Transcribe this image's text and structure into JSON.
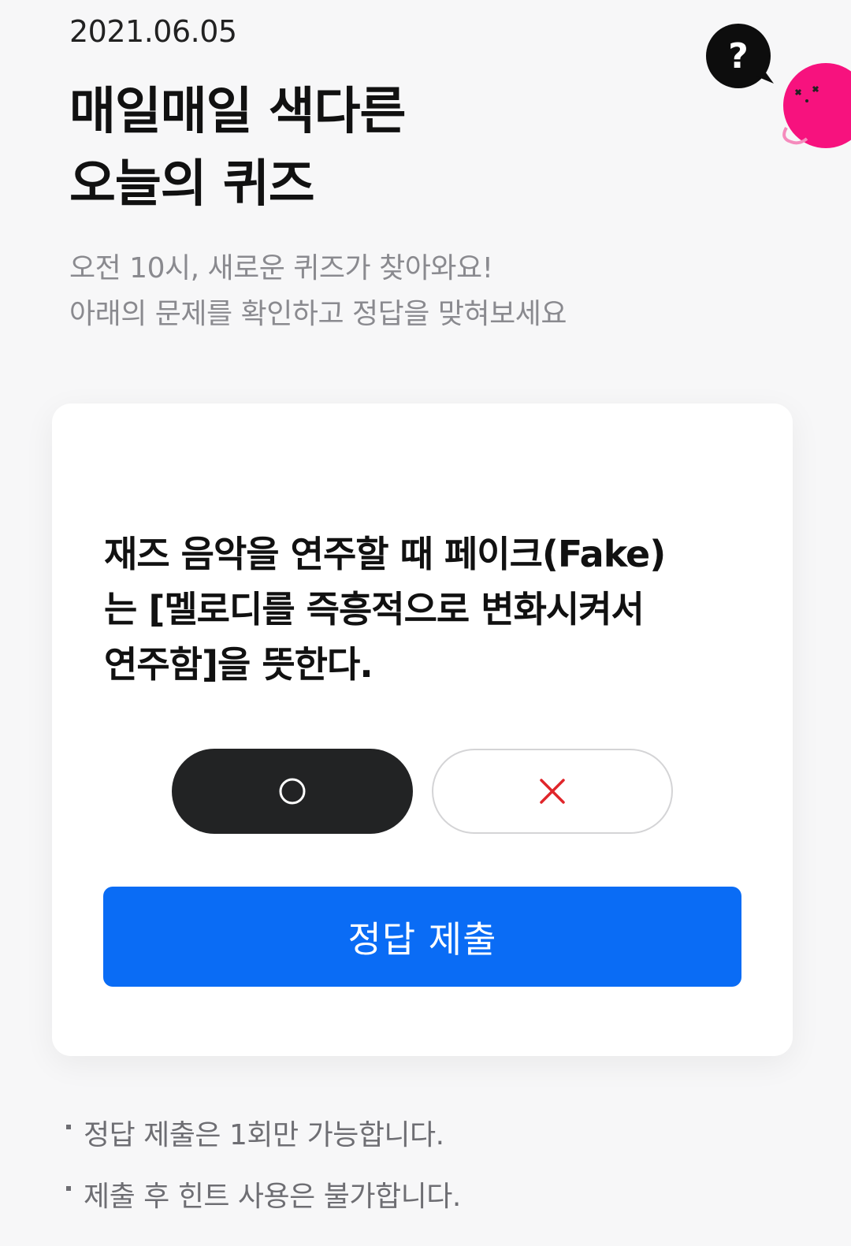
{
  "header": {
    "date": "2021.06.05",
    "title_lines": [
      "매일매일 색다른",
      "오늘의 퀴즈"
    ],
    "subtitle_lines": [
      "오전 10시, 새로운 퀴즈가 찾아와요!",
      "아래의 문제를 확인하고 정답을 맞혀보세요"
    ]
  },
  "icons": {
    "help": "question-bubble-icon",
    "mascot": "pink-mascot-icon"
  },
  "quiz": {
    "question_lines": [
      "재즈 음악을 연주할 때 페이크(Fake)",
      "는 [멜로디를 즉흥적으로 변화시켜서",
      "연주함]을 뜻한다."
    ],
    "options": {
      "o_icon": "circle-o-icon",
      "x_icon": "cross-x-icon"
    },
    "submit_label": "정답 제출"
  },
  "notes": [
    "정답 제출은 1회만 가능합니다.",
    "제출 후 힌트 사용은 불가합니다."
  ],
  "colors": {
    "accent_blue": "#0a6cf5",
    "selected_dark": "#222324",
    "x_red": "#e0252a",
    "mascot_pink": "#f7127e"
  }
}
